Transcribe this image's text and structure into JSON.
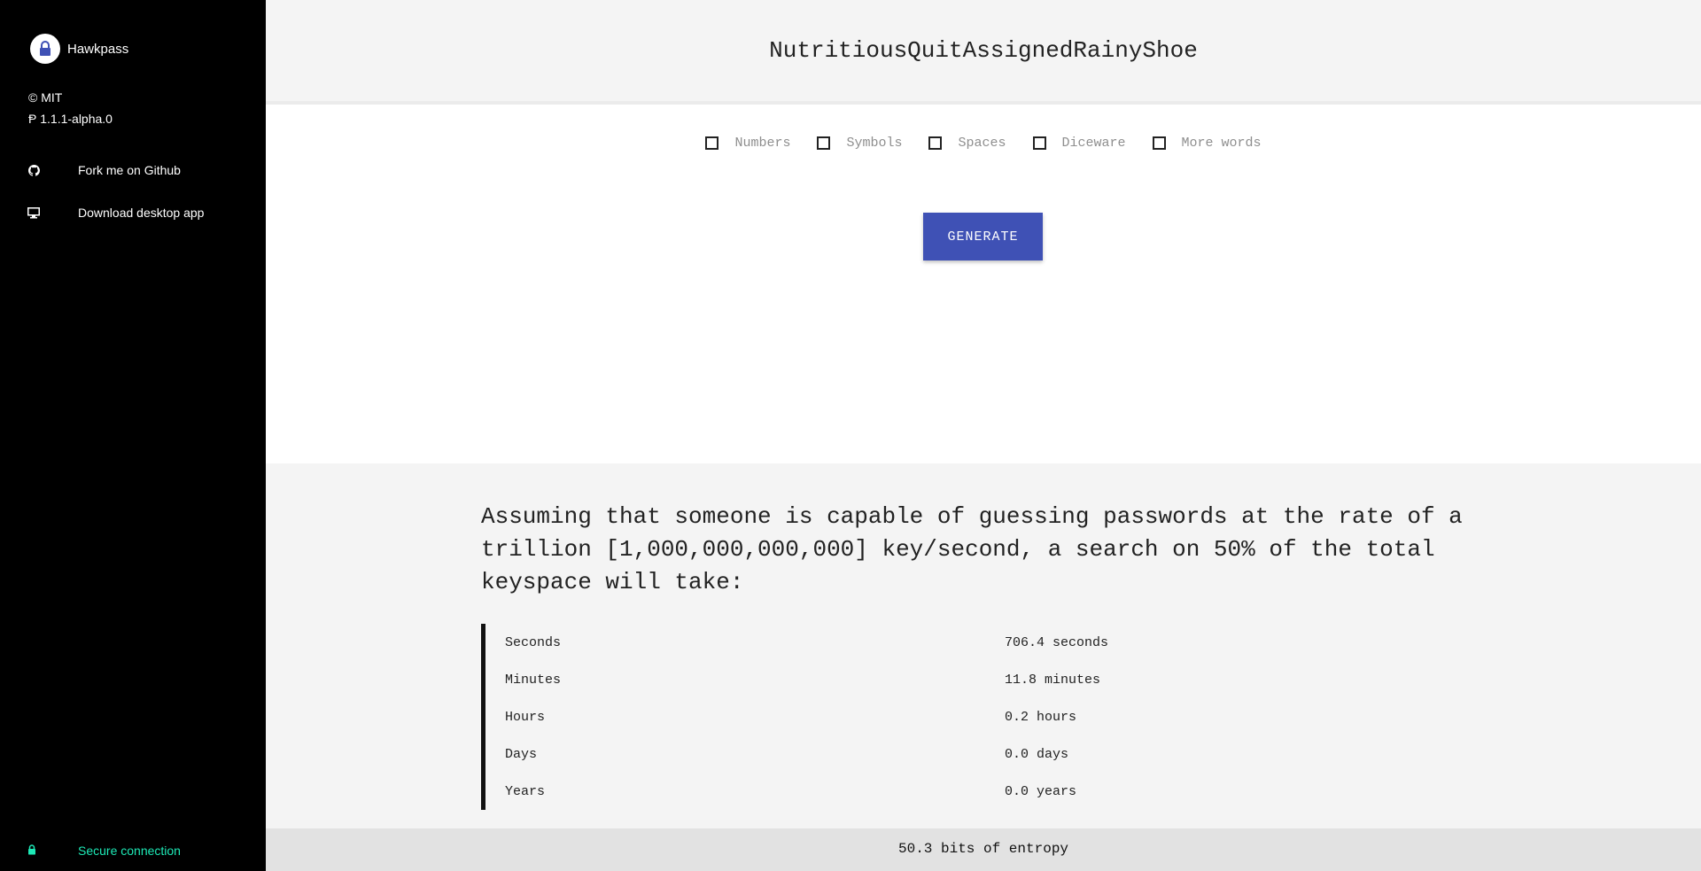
{
  "sidebar": {
    "brand": "Hawkpass",
    "license": "© MIT",
    "version": "Ᵽ 1.1.1-alpha.0",
    "nav": [
      {
        "label": "Fork me on Github",
        "icon": "github-icon"
      },
      {
        "label": "Download desktop app",
        "icon": "desktop-icon"
      }
    ],
    "status": {
      "label": "Secure connection",
      "icon": "lock-icon",
      "color": "#1de9b6"
    }
  },
  "password": "NutritiousQuitAssignedRainyShoe",
  "options": [
    {
      "label": "Numbers",
      "checked": false
    },
    {
      "label": "Symbols",
      "checked": false
    },
    {
      "label": "Spaces",
      "checked": false
    },
    {
      "label": "Diceware",
      "checked": false
    },
    {
      "label": "More words",
      "checked": false
    }
  ],
  "generate_label": "GENERATE",
  "accent_color": "#3f51b5",
  "info_text": "Assuming that someone is capable of guessing passwords at the rate of a trillion [1,000,000,000,000] key/second, a search on 50% of the total keyspace will take:",
  "times": [
    {
      "unit": "Seconds",
      "value": "706.4 seconds"
    },
    {
      "unit": "Minutes",
      "value": "11.8 minutes"
    },
    {
      "unit": "Hours",
      "value": "0.2 hours"
    },
    {
      "unit": "Days",
      "value": "0.0 days"
    },
    {
      "unit": "Years",
      "value": "0.0 years"
    }
  ],
  "entropy": "50.3 bits of entropy"
}
